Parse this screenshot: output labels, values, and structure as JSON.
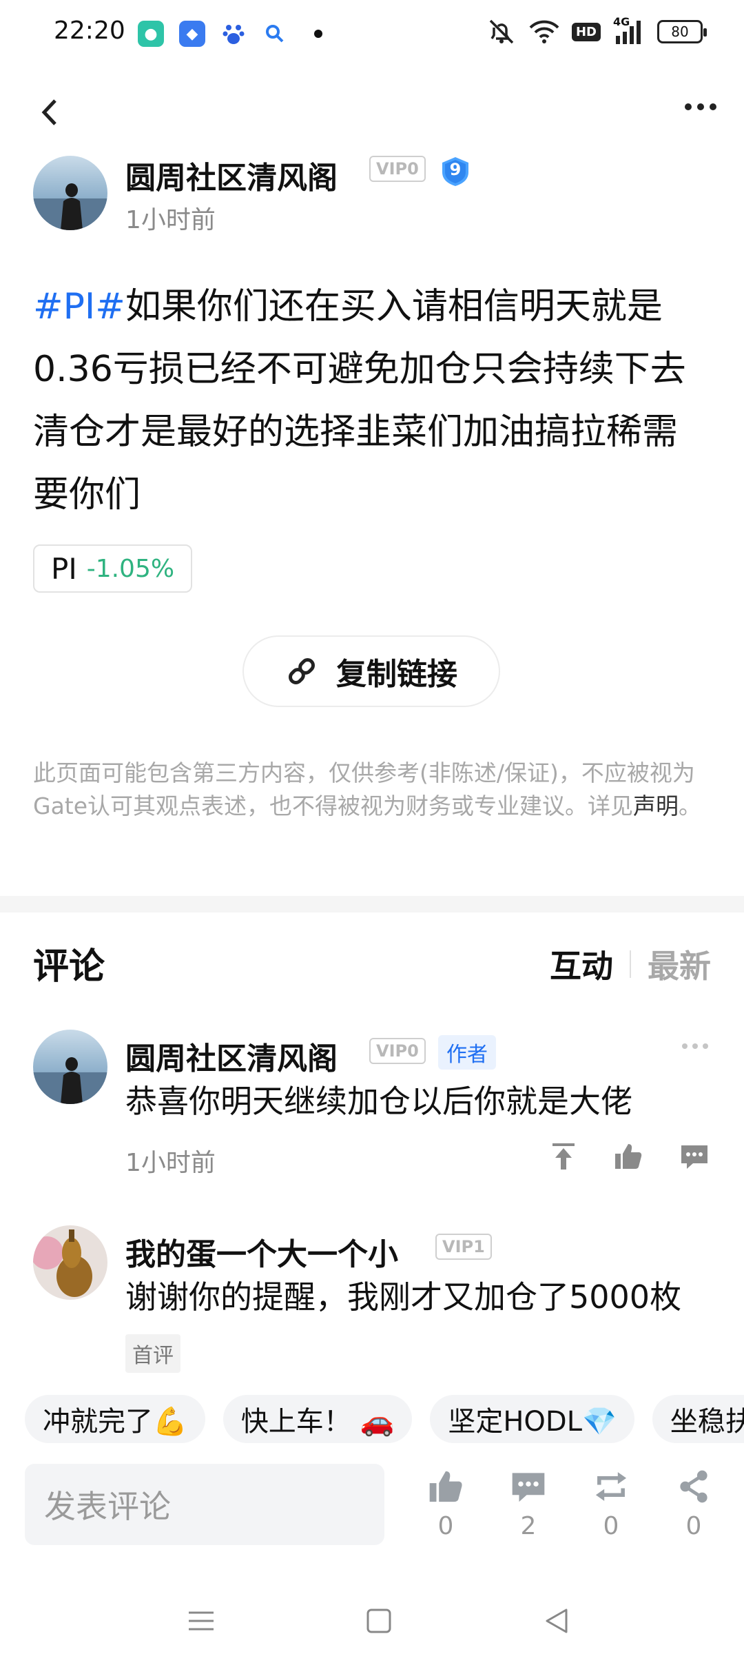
{
  "status": {
    "time": "22:20",
    "network": "4G",
    "hd": "HD",
    "battery": "80"
  },
  "post": {
    "author": "圆周社区清风阁",
    "vip": "VIP0",
    "level": "9",
    "time": "1小时前",
    "hashtag": "#PI#",
    "body": "如果你们还在买入请相信明天就是0.36亏损已经不可避免加仓只会持续下去清仓才是最好的选择韭菜们加油搞拉稀需要你们",
    "ticker": {
      "symbol": "PI",
      "change": "-1.05%"
    },
    "copy_link_label": "复制链接",
    "disclaimer": "此页面可能包含第三方内容，仅供参考(非陈述/保证)，不应被视为Gate认可其观点表述，也不得被视为财务或专业建议。详见",
    "disclaimer_link": "声明",
    "disclaimer_end": "。"
  },
  "comments": {
    "title": "评论",
    "sort_active": "互动",
    "sort_inactive": "最新",
    "items": [
      {
        "name": "圆周社区清风阁",
        "vip": "VIP0",
        "author_tag": "作者",
        "text": "恭喜你明天继续加仓以后你就是大佬",
        "time": "1小时前"
      },
      {
        "name": "我的蛋一个大一个小",
        "vip": "VIP1",
        "text": "谢谢你的提醒，我刚才又加仓了5000枚",
        "tag": "首评"
      }
    ]
  },
  "quick_replies": [
    "冲就完了💪",
    "快上车！ 🚗",
    "坚定HODL💎",
    "坐稳扶"
  ],
  "bottom_bar": {
    "input_placeholder": "发表评论",
    "like_count": "0",
    "comment_count": "2",
    "repost_count": "0",
    "share_count": "0"
  },
  "colors": {
    "accent": "#1f6ff2",
    "positive": "#2fb380"
  }
}
